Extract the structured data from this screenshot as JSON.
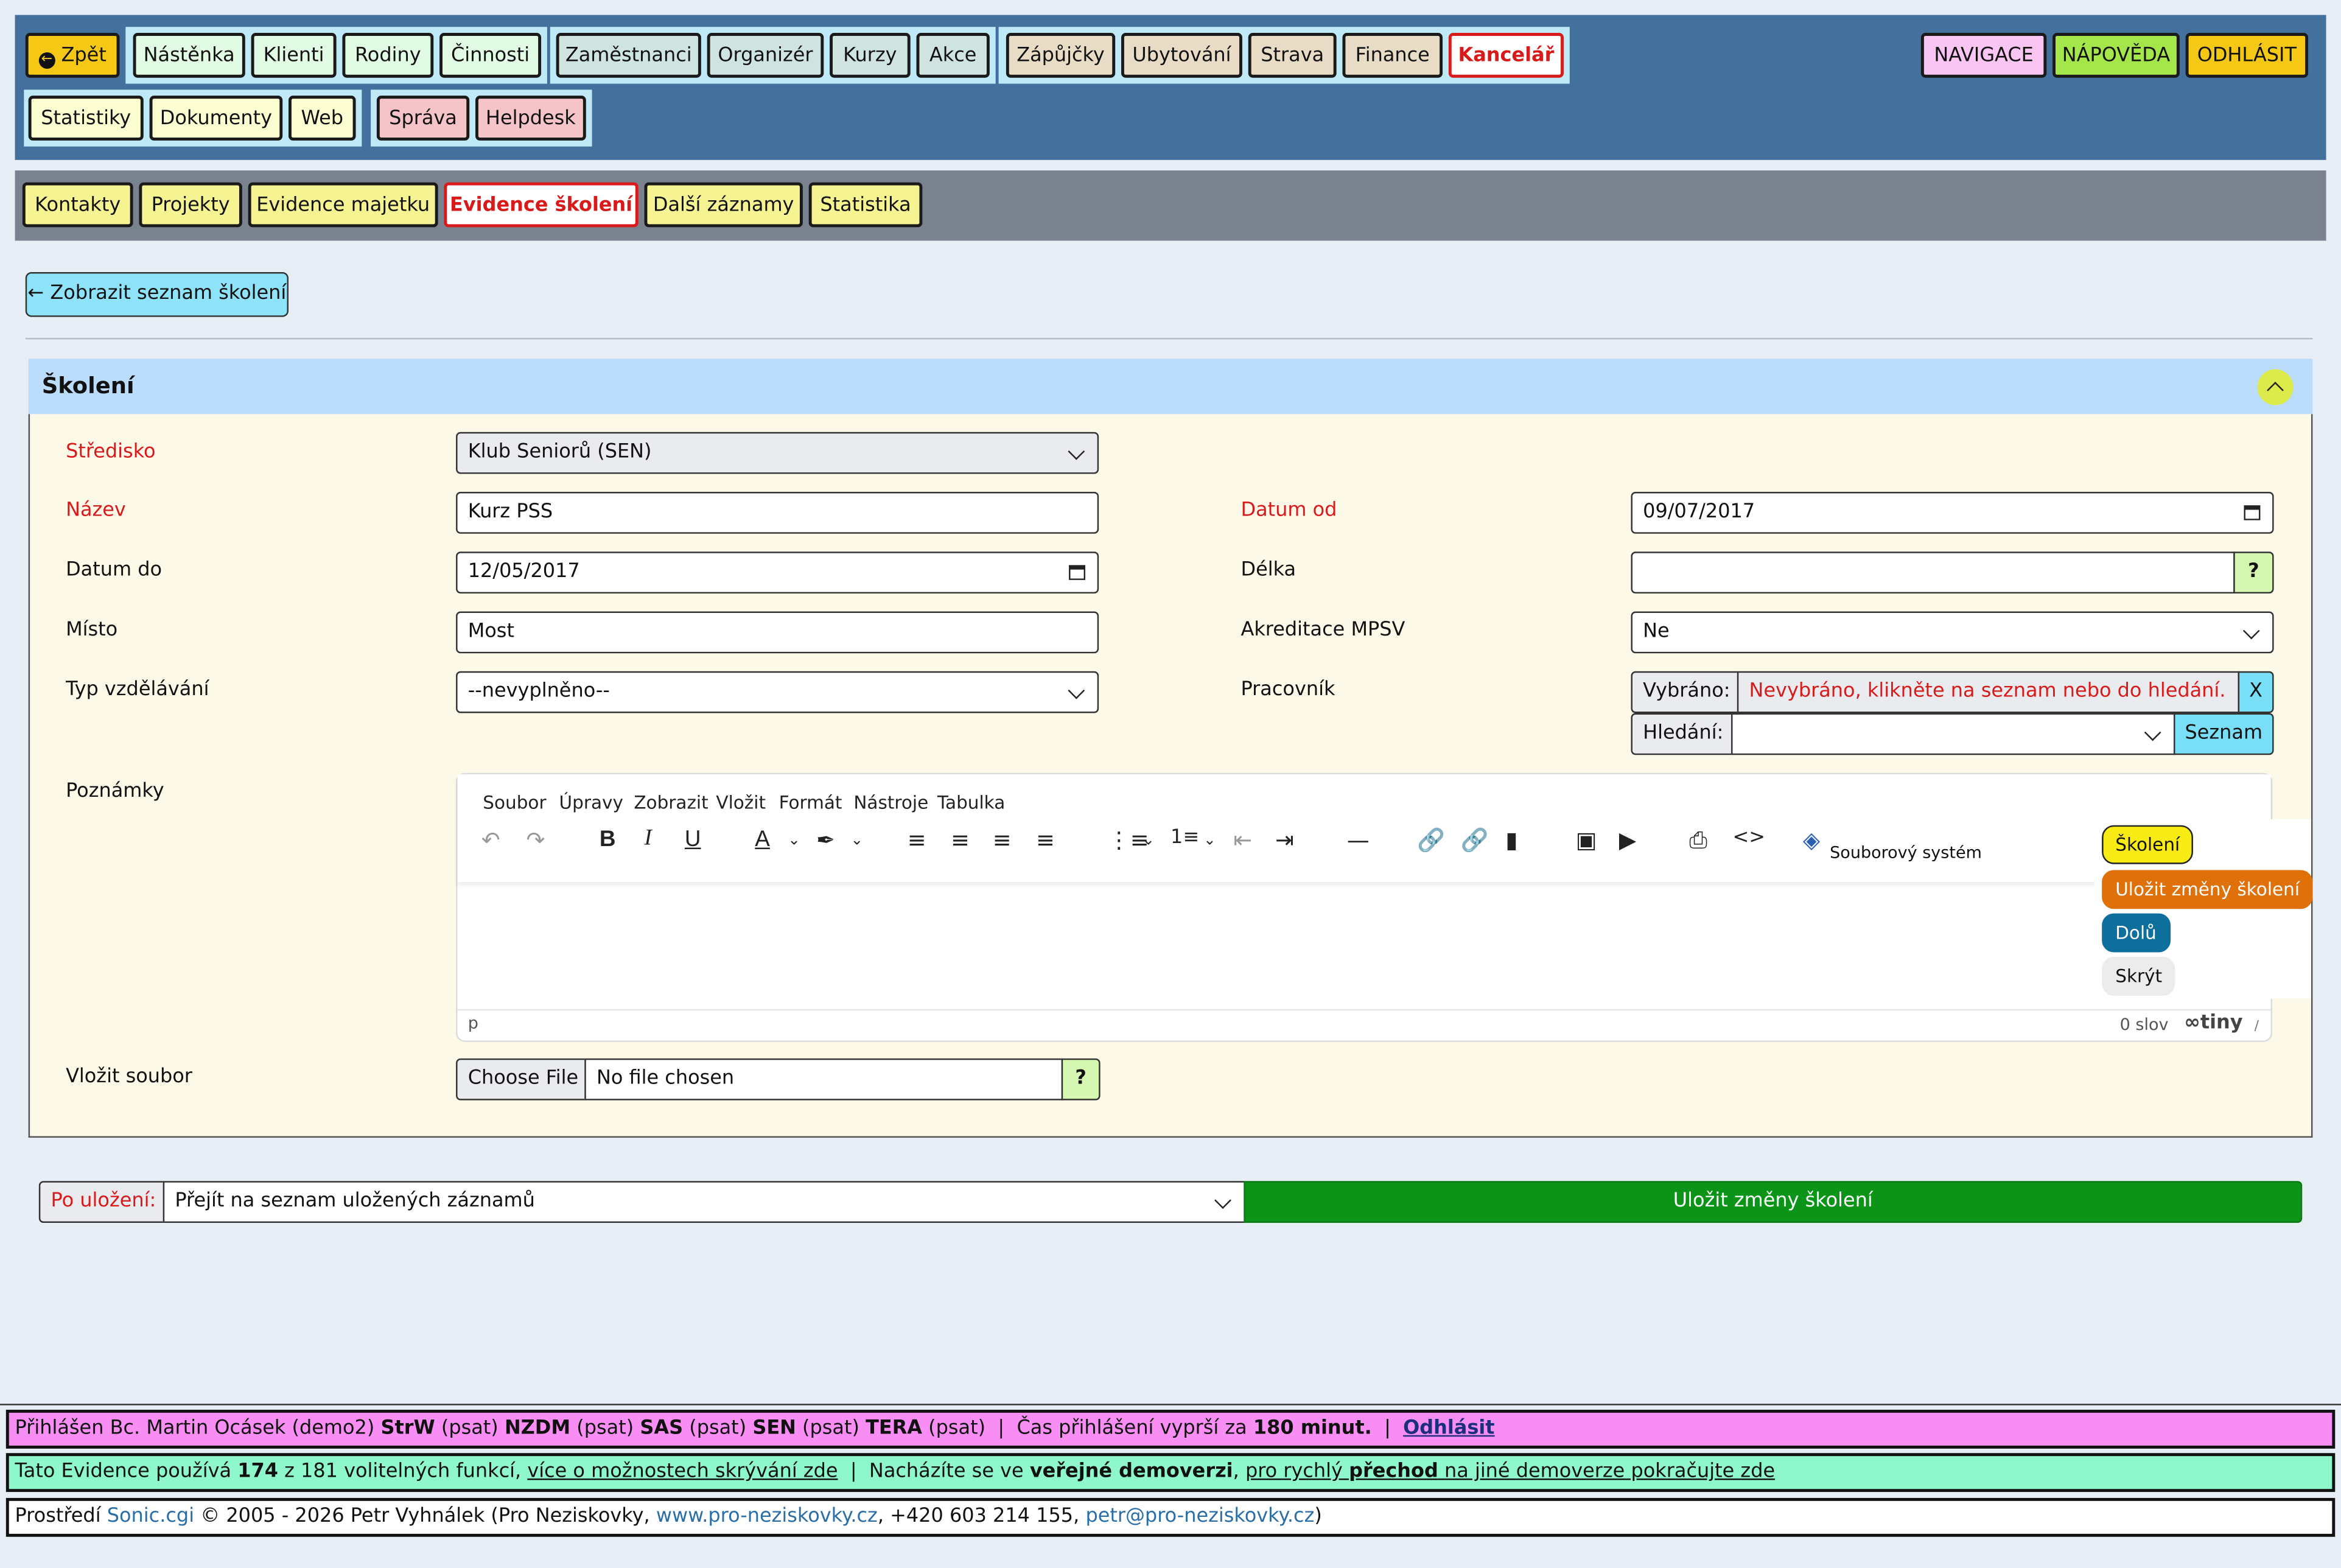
{
  "topnav": {
    "back": "Zpět",
    "group1": [
      "Nástěnka",
      "Klienti",
      "Rodiny",
      "Činnosti"
    ],
    "group2": [
      "Zaměstnanci",
      "Organizér",
      "Kurzy",
      "Akce"
    ],
    "group3": [
      "Zápůjčky",
      "Ubytování",
      "Strava",
      "Finance"
    ],
    "active": "Kancelář",
    "group4": [
      "Statistiky",
      "Dokumenty",
      "Web"
    ],
    "group5": [
      "Správa",
      "Helpdesk"
    ],
    "right": [
      "NAVIGACE",
      "NÁPOVĚDA",
      "ODHLÁSIT"
    ]
  },
  "subnav": {
    "items": [
      "Kontakty",
      "Projekty",
      "Evidence majetku",
      "Evidence školení",
      "Další záznamy",
      "Statistika"
    ],
    "active_index": 3
  },
  "back_to_list": "Zobrazit seznam školení",
  "panel": {
    "title": "Školení"
  },
  "form": {
    "stredisko": {
      "label": "Středisko",
      "value": "Klub Seniorů (SEN)"
    },
    "nazev": {
      "label": "Název",
      "value": "Kurz PSS"
    },
    "datum_od": {
      "label": "Datum od",
      "value": "09/07/2017"
    },
    "datum_do": {
      "label": "Datum do",
      "value": "12/05/2017"
    },
    "delka": {
      "label": "Délka",
      "value": "",
      "help": "?"
    },
    "misto": {
      "label": "Místo",
      "value": "Most"
    },
    "akreditace": {
      "label": "Akreditace MPSV",
      "value": "Ne"
    },
    "typ": {
      "label": "Typ vzdělávání",
      "value": "--nevyplněno--"
    },
    "pracovnik": {
      "label": "Pracovník",
      "selected_label": "Vybráno:",
      "selected_value": "Nevybráno, klikněte na seznam nebo do hledání.",
      "clear": "X",
      "search_label": "Hledání:",
      "list_button": "Seznam"
    },
    "poznamky": {
      "label": "Poznámky"
    },
    "soubor": {
      "label": "Vložit soubor",
      "button": "Choose File",
      "status": "No file chosen",
      "help": "?"
    }
  },
  "editor": {
    "menu": [
      "Soubor",
      "Úpravy",
      "Zobrazit",
      "Vložit",
      "Formát",
      "Nástroje",
      "Tabulka"
    ],
    "file_system": "Souborový systém",
    "status_path": "p",
    "word_count": "0 slov",
    "brand": "tiny"
  },
  "floating": {
    "title": "Školení",
    "save": "Uložit změny školení",
    "down": "Dolů",
    "hide": "Skrýt"
  },
  "after_save": {
    "label": "Po uložení:",
    "value": "Přejít na seznam uložených záznamů",
    "submit": "Uložit změny školení"
  },
  "footer": {
    "login": {
      "prefix": "Přihlášen Bc. Martin Ocásek (demo2)",
      "perms": [
        {
          "code": "StrW",
          "mode": "(psat)"
        },
        {
          "code": "NZDM",
          "mode": "(psat)"
        },
        {
          "code": "SAS",
          "mode": "(psat)"
        },
        {
          "code": "SEN",
          "mode": "(psat)"
        },
        {
          "code": "TERA",
          "mode": "(psat)"
        }
      ],
      "sep": "|",
      "expire_prefix": "Čas přihlášení vyprší za",
      "expire_value": "180 minut.",
      "logout": "Odhlásit"
    },
    "features": {
      "p1": "Tato Evidence používá",
      "count": "174",
      "p2": "z 181 volitelných funkcí,",
      "link1": "více o možnostech skrývání zde",
      "sep": "|",
      "p3": "Nacházíte se ve",
      "bold": "veřejné demoverzi",
      "comma": ",",
      "link2a": "pro rychlý",
      "link2b": "přechod",
      "link2c": "na jiné demoverze pokračujte zde"
    },
    "copyright": {
      "p1": "Prostředí",
      "product": "Sonic.cgi",
      "p2": "© 2005 - 2026 Petr Vyhnálek (Pro Neziskovky,",
      "web": "www.pro-neziskovky.cz",
      "p3": ", +420 603 214 155,",
      "email": "petr@pro-neziskovky.cz",
      "p4": ")"
    }
  },
  "colors": {
    "topbar": "#44709e",
    "subbar": "#7a8290",
    "accent_red": "#d91a1a",
    "save_green": "#0b9418",
    "panel_header": "#bcdcfb",
    "panel_body": "#fdf9e9"
  }
}
